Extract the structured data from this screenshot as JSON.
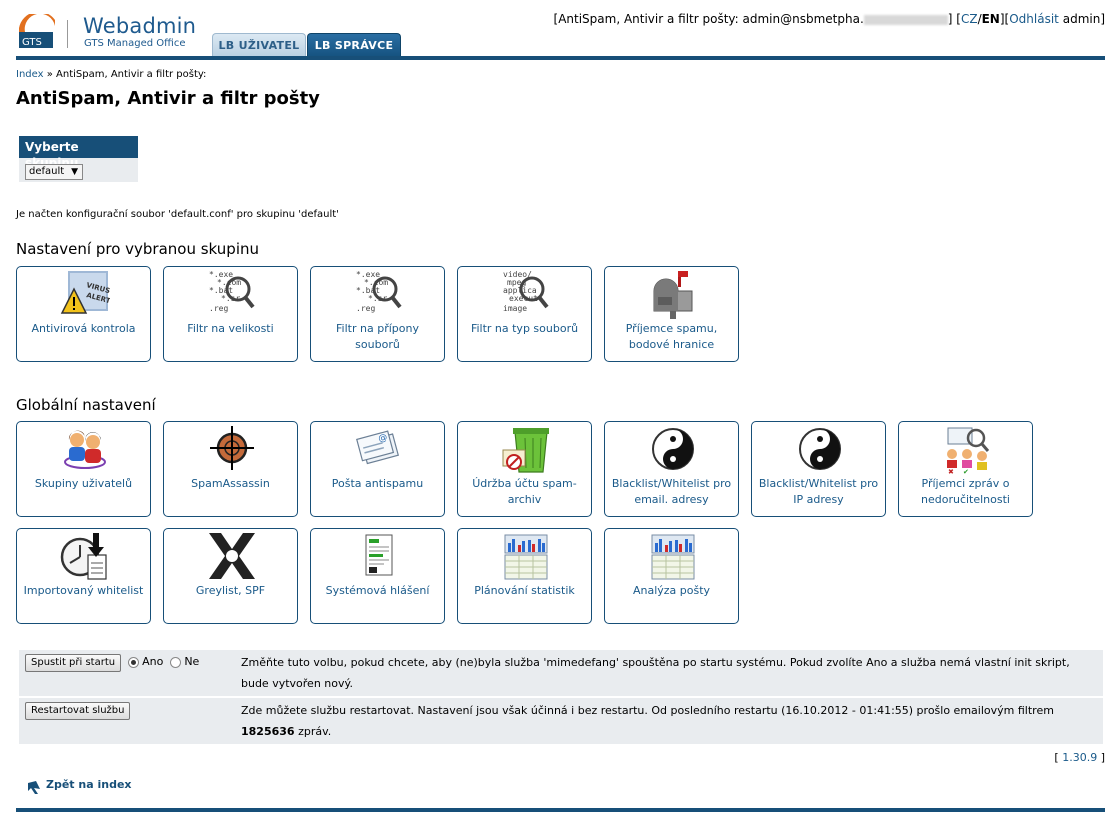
{
  "header": {
    "logo_mark": "GTS",
    "logo_title": "Webadmin",
    "logo_sub": "GTS Managed Office",
    "tabs": [
      {
        "label": "LB UŽIVATEL"
      },
      {
        "label": "LB SPRÁVCE"
      }
    ],
    "userinfo": {
      "prefix": "[AntiSpam, Antivir a filtr pošty: admin@nsbmetpha.",
      "suffix": "] [",
      "lang_cz": "CZ",
      "lang_sep": "/",
      "lang_en": "EN",
      "mid": "][",
      "logout": "Odhlásit",
      "user": "admin]"
    }
  },
  "breadcrumb": {
    "index": "Index",
    "sep": " » ",
    "current": "AntiSpam, Antivir a filtr pošty:"
  },
  "page_title": "AntiSpam, Antivir a filtr pošty",
  "group": {
    "heading": "Vyberte skupinu",
    "selected": "default"
  },
  "config_note": "Je načten konfigurační soubor 'default.conf' pro skupinu 'default'",
  "group_section": {
    "title": "Nastavení pro vybranou skupinu",
    "tiles": [
      {
        "label": "Antivirová kontrola",
        "icon": "virus-alert-icon"
      },
      {
        "label": "Filtr na velikosti",
        "icon": "magnifier-files-icon"
      },
      {
        "label": "Filtr na přípony souborů",
        "icon": "magnifier-extensions-icon"
      },
      {
        "label": "Filtr na typ souborů",
        "icon": "magnifier-mime-icon"
      },
      {
        "label": "Příjemce spamu, bodové hranice",
        "icon": "mailbox-icon"
      }
    ]
  },
  "global_section": {
    "title": "Globální nastavení",
    "tiles": [
      {
        "label": "Skupiny uživatelů",
        "icon": "users-group-icon"
      },
      {
        "label": "SpamAssassin",
        "icon": "crosshair-icon"
      },
      {
        "label": "Pošta antispamu",
        "icon": "envelope-icon"
      },
      {
        "label": "Údržba účtu spam-archiv",
        "icon": "trash-bin-icon"
      },
      {
        "label": "Blacklist/Whitelist pro email. adresy",
        "icon": "yin-yang-icon"
      },
      {
        "label": "Blacklist/Whitelist pro IP adresy",
        "icon": "yin-yang-icon"
      },
      {
        "label": "Příjemci zpráv o nedoručitelnosti",
        "icon": "recipients-icon"
      },
      {
        "label": "Importovaný whitelist",
        "icon": "clock-import-icon"
      },
      {
        "label": "Greylist, SPF",
        "icon": "greylist-icon"
      },
      {
        "label": "Systémová hlášení",
        "icon": "report-icon"
      },
      {
        "label": "Plánování statistik",
        "icon": "stats-plan-icon"
      },
      {
        "label": "Analýza pošty",
        "icon": "stats-analysis-icon"
      }
    ]
  },
  "settings": {
    "start_button": "Spustit při startu",
    "radio_yes": "Ano",
    "radio_no": "Ne",
    "start_text": "Změňte tuto volbu, pokud chcete, aby (ne)byla služba 'mimedefang' spouštěna po startu systému. Pokud zvolíte Ano a služba nemá vlastní init skript, bude vytvořen nový.",
    "restart_button": "Restartovat službu",
    "restart_text_a": "Zde můžete službu restartovat. Nastavení jsou však účinná i bez restartu. Od posledního restartu (16.10.2012 - 01:41:55) prošlo emailovým filtrem",
    "restart_count": "1825636",
    "restart_text_b": "zpráv."
  },
  "version": {
    "open": "[ ",
    "value": "1.30.9",
    "close": " ]"
  },
  "back_link": "Zpět na index",
  "colors": {
    "brand": "#174f78",
    "link": "#1a5a8a",
    "panel": "#e9ecef"
  }
}
